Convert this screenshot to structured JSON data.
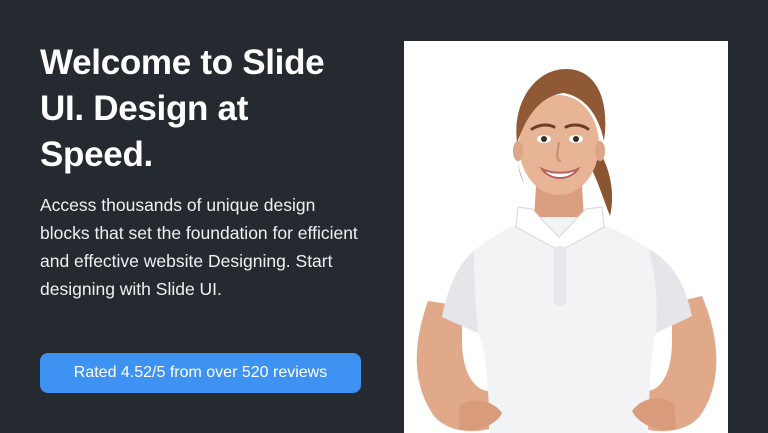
{
  "hero": {
    "title": "Welcome to Slide UI. Design at Speed.",
    "description": "Access thousands of unique design blocks that set the foundation for efficient and effective website Designing. Start designing with Slide UI.",
    "rating_label": "Rated 4.52/5 from over 520 reviews"
  },
  "colors": {
    "background": "#252a30",
    "accent": "#3e93f2",
    "text": "#ffffff"
  }
}
